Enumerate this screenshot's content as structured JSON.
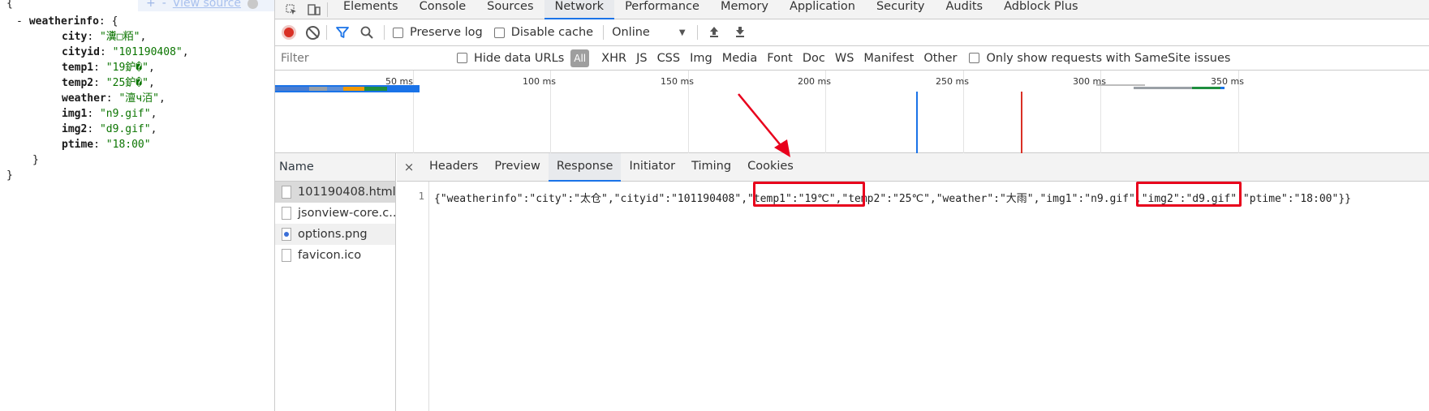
{
  "json_view": {
    "toolbar": {
      "expand": "+",
      "collapse": "-",
      "view_source": "View source"
    },
    "lines": [
      {
        "indent": 0,
        "text": "{"
      },
      {
        "indent": 1,
        "toggle": "-",
        "key": "weatherinfo",
        "punct": ": {"
      },
      {
        "indent": 3,
        "key": "city",
        "value": "\"瀵□粨\"",
        "punct": ","
      },
      {
        "indent": 3,
        "key": "cityid",
        "value": "\"101190408\"",
        "punct": ","
      },
      {
        "indent": 3,
        "key": "temp1",
        "value": "\"19鈩�\"",
        "punct": ","
      },
      {
        "indent": 3,
        "key": "temp2",
        "value": "\"25鈩�\"",
        "punct": ","
      },
      {
        "indent": 3,
        "key": "weather",
        "value": "\"澶ч洦\"",
        "punct": ","
      },
      {
        "indent": 3,
        "key": "img1",
        "value": "\"n9.gif\"",
        "punct": ","
      },
      {
        "indent": 3,
        "key": "img2",
        "value": "\"d9.gif\"",
        "punct": ","
      },
      {
        "indent": 3,
        "key": "ptime",
        "value": "\"18:00\"",
        "punct": ""
      },
      {
        "indent": 2,
        "text": "}"
      },
      {
        "indent": 0,
        "text": "}"
      }
    ]
  },
  "devtools": {
    "tabs": [
      "Elements",
      "Console",
      "Sources",
      "Network",
      "Performance",
      "Memory",
      "Application",
      "Security",
      "Audits",
      "Adblock Plus"
    ],
    "active_tab": "Network",
    "netbar": {
      "preserve_log": "Preserve log",
      "disable_cache": "Disable cache",
      "throttle": "Online",
      "throttle_caret": "▼"
    },
    "filterbar": {
      "placeholder": "Filter",
      "hide_data_urls": "Hide data URLs",
      "types": [
        "All",
        "XHR",
        "JS",
        "CSS",
        "Img",
        "Media",
        "Font",
        "Doc",
        "WS",
        "Manifest",
        "Other"
      ],
      "samesite": "Only show requests with SameSite issues"
    },
    "timeline": {
      "ticks": [
        "50 ms",
        "100 ms",
        "150 ms",
        "200 ms",
        "250 ms",
        "300 ms",
        "350 ms"
      ],
      "dom_content_loaded_ms": 233,
      "load_ms": 271
    },
    "requests": {
      "header": "Name",
      "items": [
        "101190408.html",
        "jsonview-core.c...",
        "options.png",
        "favicon.ico"
      ]
    },
    "detail": {
      "close": "×",
      "tabs": [
        "Headers",
        "Preview",
        "Response",
        "Initiator",
        "Timing",
        "Cookies"
      ],
      "active_tab": "Response",
      "line_number": "1",
      "response_text": "{\"weatherinfo\":\"city\":\"太仓\",\"cityid\":\"101190408\",\"temp1\":\"19℃\",\"temp2\":\"25℃\",\"weather\":\"大雨\",\"img1\":\"n9.gif\",\"img2\":\"d9.gif\",\"ptime\":\"18:00\"}}"
    }
  },
  "colors": {
    "accent": "#1a73e8",
    "annotation": "#e8001c",
    "record": "#d93025",
    "json_string": "#0b7500"
  }
}
